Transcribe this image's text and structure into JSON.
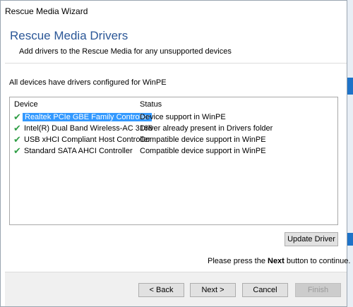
{
  "window": {
    "title": "Rescue Media Wizard"
  },
  "header": {
    "title": "Rescue Media Drivers",
    "subtitle": "Add drivers to the Rescue Media for any unsupported devices"
  },
  "status_line": "All devices have drivers configured for WinPE",
  "device_list": {
    "columns": {
      "device": "Device",
      "status": "Status"
    },
    "rows": [
      {
        "device": "Realtek PCIe GBE Family Controller",
        "status": "Device support in WinPE",
        "selected": true
      },
      {
        "device": "Intel(R) Dual Band Wireless-AC 3168",
        "status": "Driver already present in Drivers folder",
        "selected": false
      },
      {
        "device": "USB xHCI Compliant Host Controller",
        "status": "Compatible device support in WinPE",
        "selected": false
      },
      {
        "device": "Standard SATA AHCI Controller",
        "status": "Compatible device support in WinPE",
        "selected": false
      }
    ]
  },
  "update_driver_label": "Update Driver",
  "press_note": {
    "before": "Please press the ",
    "bold": "Next",
    "after": " button to continue."
  },
  "buttons": {
    "back": "< Back",
    "next": "Next >",
    "cancel": "Cancel",
    "finish": "Finish"
  },
  "colors": {
    "header_blue": "#2b5797",
    "check_green": "#2f9e45",
    "selection": "#3399ff"
  }
}
